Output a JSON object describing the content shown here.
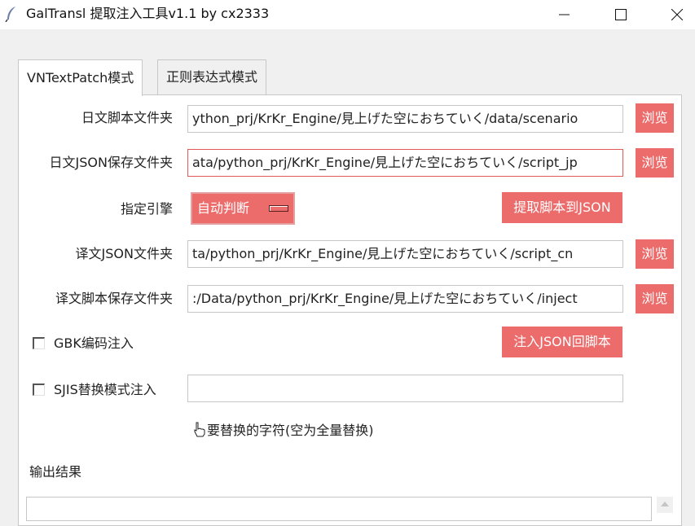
{
  "window": {
    "title": "GalTransl 提取注入工具v1.1 by cx2333",
    "icon": "feather-icon"
  },
  "tabs": [
    {
      "label": "VNTextPatch模式",
      "active": true
    },
    {
      "label": "正则表达式模式",
      "active": false
    }
  ],
  "form": {
    "jp_script_dir": {
      "label": "日文脚本文件夹",
      "value": "ython_prj/KrKr_Engine/見上げた空におちていく/data/scenario",
      "browse": "浏览"
    },
    "jp_json_dir": {
      "label": "日文JSON保存文件夹",
      "value": "ata/python_prj/KrKr_Engine/見上げた空におちていく/script_jp",
      "browse": "浏览"
    },
    "engine": {
      "label": "指定引擎",
      "selected": "自动判断"
    },
    "extract_button": "提取脚本到JSON",
    "cn_json_dir": {
      "label": "译文JSON文件夹",
      "value": "ta/python_prj/KrKr_Engine/見上げた空におちていく/script_cn",
      "browse": "浏览"
    },
    "cn_script_dir": {
      "label": "译文脚本保存文件夹",
      "value": ":/Data/python_prj/KrKr_Engine/見上げた空におちていく/inject",
      "browse": "浏览"
    },
    "gbk_inject": {
      "label": "GBK编码注入",
      "checked": false
    },
    "inject_button": "注入JSON回脚本",
    "sjis_replace": {
      "label": "SJIS替换模式注入",
      "checked": false,
      "value": ""
    },
    "replace_hint": "要替换的字符(空为全量替换)"
  },
  "output": {
    "label": "输出结果",
    "value": ""
  },
  "colors": {
    "accent": "#ec6b6b",
    "panel": "#ffffff",
    "window_bg": "#f0f0f0",
    "focus_border": "#e05a5a"
  }
}
